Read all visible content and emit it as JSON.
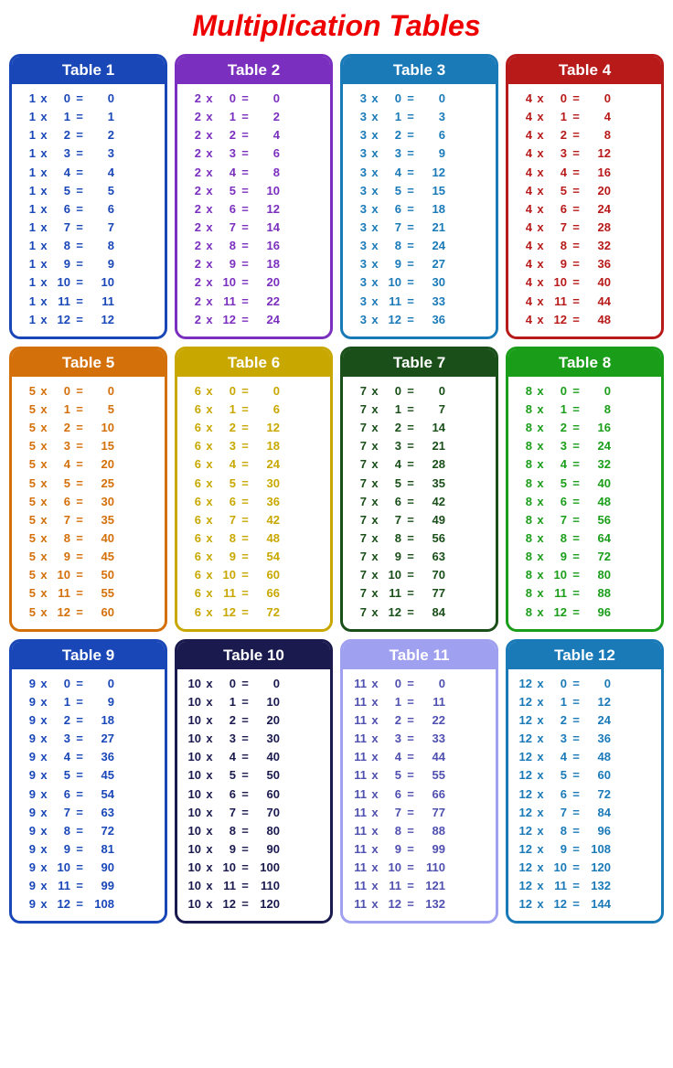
{
  "title": "Multiplication Tables",
  "tables": [
    {
      "id": 1,
      "label": "Table 1",
      "class": "t1",
      "multiplier": 1
    },
    {
      "id": 2,
      "label": "Table 2",
      "class": "t2",
      "multiplier": 2
    },
    {
      "id": 3,
      "label": "Table 3",
      "class": "t3",
      "multiplier": 3
    },
    {
      "id": 4,
      "label": "Table 4",
      "class": "t4",
      "multiplier": 4
    },
    {
      "id": 5,
      "label": "Table 5",
      "class": "t5",
      "multiplier": 5
    },
    {
      "id": 6,
      "label": "Table 6",
      "class": "t6",
      "multiplier": 6
    },
    {
      "id": 7,
      "label": "Table 7",
      "class": "t7",
      "multiplier": 7
    },
    {
      "id": 8,
      "label": "Table 8",
      "class": "t8",
      "multiplier": 8
    },
    {
      "id": 9,
      "label": "Table 9",
      "class": "t9",
      "multiplier": 9
    },
    {
      "id": 10,
      "label": "Table 10",
      "class": "t10",
      "multiplier": 10
    },
    {
      "id": 11,
      "label": "Table 11",
      "class": "t11",
      "multiplier": 11
    },
    {
      "id": 12,
      "label": "Table 12",
      "class": "t12",
      "multiplier": 12
    }
  ]
}
